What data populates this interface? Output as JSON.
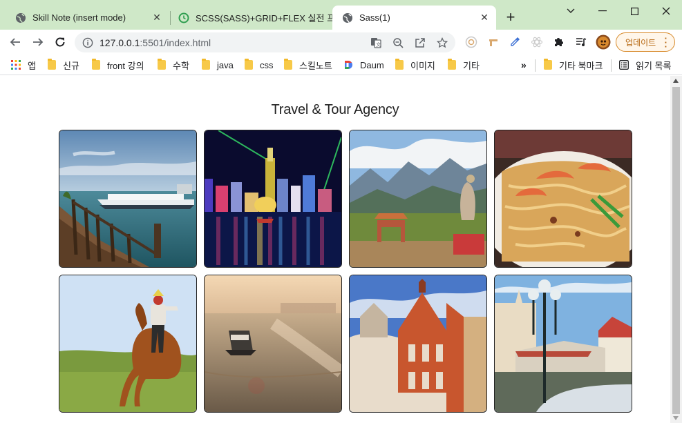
{
  "tabs": [
    {
      "title": "Skill Note (insert mode)",
      "active": false
    },
    {
      "title": "SCSS(SASS)+GRID+FLEX 실전 프",
      "active": false
    },
    {
      "title": "Sass(1)",
      "active": true
    }
  ],
  "toolbar": {
    "url_host": "127.0.0.1",
    "url_path": ":5501/index.html",
    "update_label": "업데이트"
  },
  "bookmarks": {
    "items": [
      "앱",
      "신규",
      "front 강의",
      "수학",
      "java",
      "css",
      "스킬노트",
      "Daum",
      "이미지",
      "기타"
    ],
    "overflow": "»",
    "other": "기타 북마크",
    "reading_list": "읽기 목록"
  },
  "page": {
    "title": "Travel & Tour Agency",
    "images": [
      "pier-boat",
      "night-skyline",
      "temple-mountains",
      "pad-thai",
      "horse-rider",
      "river-ship",
      "gothic-building",
      "plaza-lamppost"
    ]
  },
  "colors": {
    "tabstrip": "#cfe8c8",
    "update_accent": "#d88a2a"
  }
}
